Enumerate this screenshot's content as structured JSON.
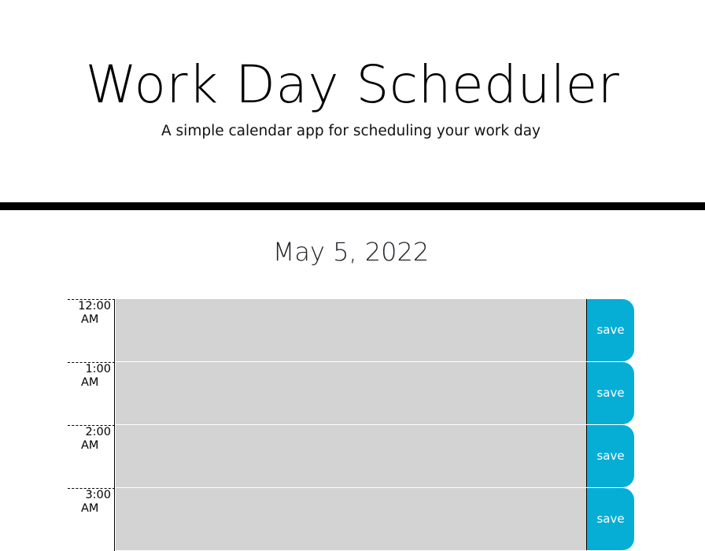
{
  "header": {
    "title": "Work Day Scheduler",
    "subtitle": "A simple calendar app for scheduling your work day"
  },
  "current_day": "May 5, 2022",
  "colors": {
    "divider": "#000000",
    "description_bg": "#d3d3d3",
    "save_bg": "#06aed5",
    "save_text": "#ffffff"
  },
  "time_blocks": [
    {
      "hour": "12:00",
      "period": "AM",
      "description": "",
      "save_label": "save"
    },
    {
      "hour": "1:00",
      "period": "AM",
      "description": "",
      "save_label": "save"
    },
    {
      "hour": "2:00",
      "period": "AM",
      "description": "",
      "save_label": "save"
    },
    {
      "hour": "3:00",
      "period": "AM",
      "description": "",
      "save_label": "save"
    }
  ]
}
